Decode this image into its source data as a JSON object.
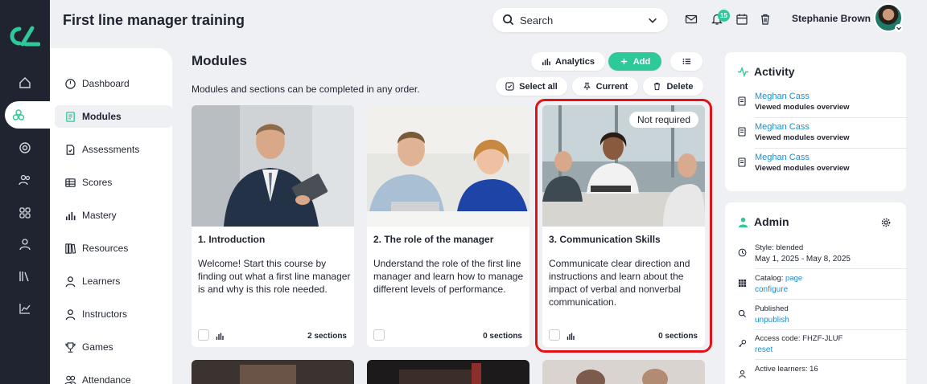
{
  "header": {
    "title": "First line manager training",
    "search_placeholder": "Search",
    "notifications_count": "15",
    "user_name": "Stephanie Brown"
  },
  "nav": {
    "items": [
      {
        "label": "Dashboard",
        "icon": "dashboard-icon"
      },
      {
        "label": "Modules",
        "icon": "modules-icon"
      },
      {
        "label": "Assessments",
        "icon": "assessment-icon"
      },
      {
        "label": "Scores",
        "icon": "table-icon"
      },
      {
        "label": "Mastery",
        "icon": "bar-chart-icon"
      },
      {
        "label": "Resources",
        "icon": "books-icon"
      },
      {
        "label": "Learners",
        "icon": "person-icon"
      },
      {
        "label": "Instructors",
        "icon": "person-icon"
      },
      {
        "label": "Games",
        "icon": "trophy-icon"
      },
      {
        "label": "Attendance",
        "icon": "people-icon"
      }
    ],
    "active": "Modules"
  },
  "main": {
    "title": "Modules",
    "subtitle": "Modules and sections can be completed in any order.",
    "toolbar": {
      "analytics": "Analytics",
      "add": "Add",
      "select_all": "Select all",
      "current": "Current",
      "delete": "Delete"
    },
    "cards": [
      {
        "title": "1. Introduction",
        "description": "Welcome! Start this course by finding out what a first line manager is and why is this role needed.",
        "sections": "2 sections",
        "tag": ""
      },
      {
        "title": "2. The role of the manager",
        "description": "Understand the role of the first line manager and learn how to manage different levels of performance.",
        "sections": "0 sections",
        "tag": ""
      },
      {
        "title": "3. Communication Skills",
        "description": "Communicate clear direction and instructions and learn about the impact of verbal and nonverbal communication.",
        "sections": "0 sections",
        "tag": "Not required"
      }
    ]
  },
  "activity": {
    "title": "Activity",
    "items": [
      {
        "who": "Meghan Cass",
        "what": "Viewed modules overview"
      },
      {
        "who": "Meghan Cass",
        "what": "Viewed modules overview"
      },
      {
        "who": "Meghan Cass",
        "what": "Viewed modules overview"
      }
    ]
  },
  "admin": {
    "title": "Admin",
    "style_label": "Style: blended",
    "dates": "May 1, 2025 - May 8, 2025",
    "catalog_label": "Catalog:",
    "catalog_link": "page",
    "catalog_action": "configure",
    "published_label": "Published",
    "published_action": "unpublish",
    "access_label": "Access code: FHZF-JLUF",
    "access_action": "reset",
    "active_learners": "Active learners: 16"
  },
  "colors": {
    "accent": "#2ec99a",
    "link": "#1c8fd1",
    "rail": "#1f2430",
    "highlight": "#e01318"
  }
}
